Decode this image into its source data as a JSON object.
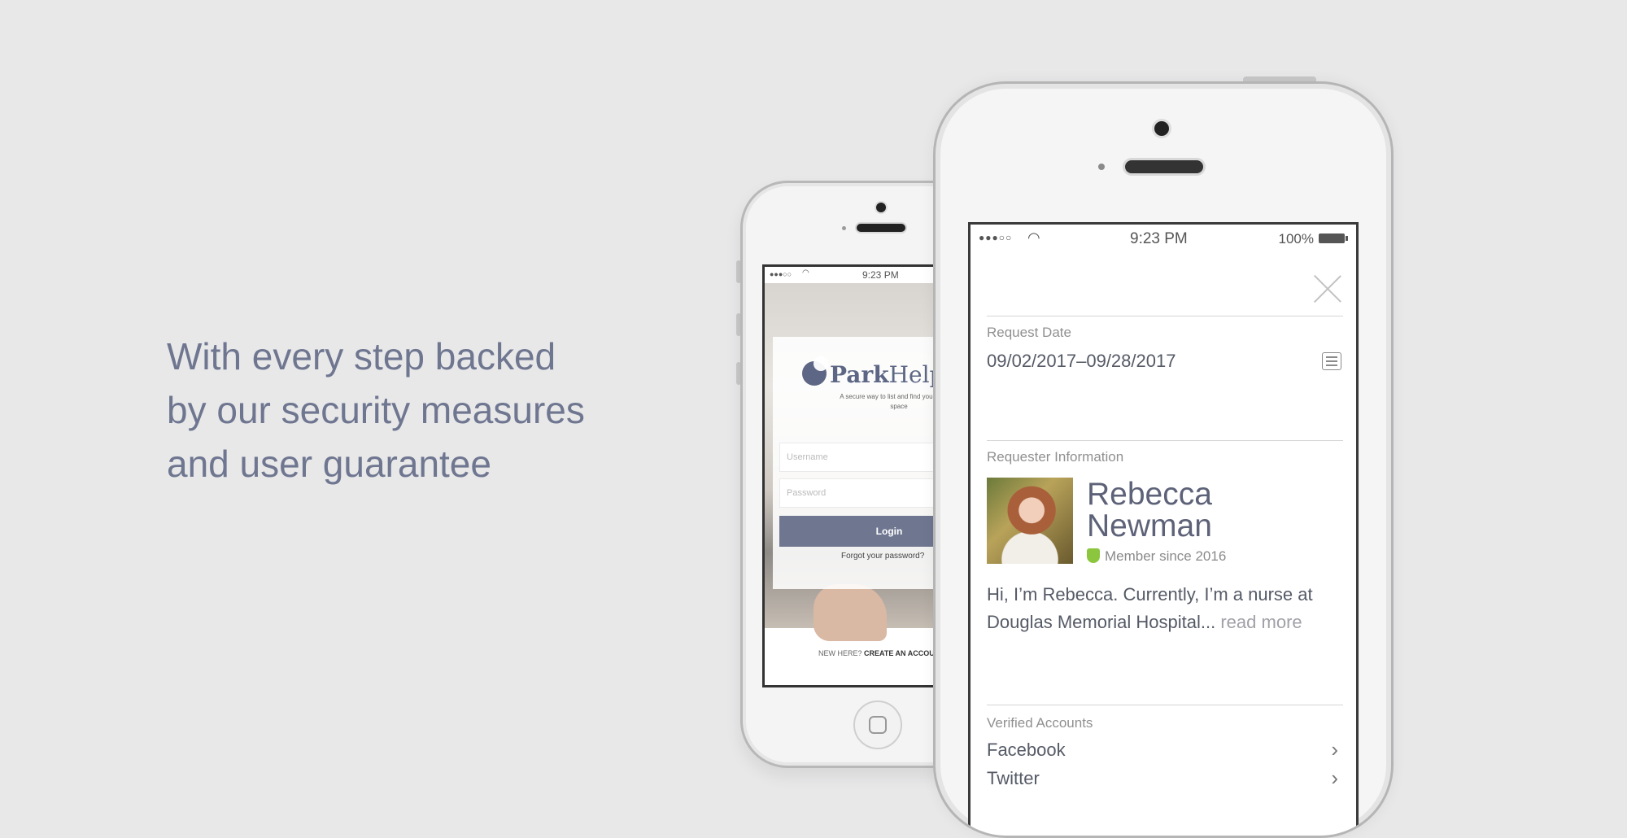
{
  "tagline": [
    "With every step backed",
    "by our security measures",
    "and user guarantee"
  ],
  "login_screen": {
    "status_time": "9:23 PM",
    "logo_bold": "Park",
    "logo_light": "Help",
    "tagline": "A secure way to list and find your parking space",
    "username_placeholder": "Username",
    "password_placeholder": "Password",
    "login_button": "Login",
    "forgot_link": "Forgot your password?",
    "new_here": "NEW HERE?",
    "create_account": "CREATE AN ACCOUNT"
  },
  "detail_screen": {
    "status_signal": "●●●○○",
    "status_time": "9:23 PM",
    "battery": "100%",
    "request_date_label": "Request Date",
    "request_date_value": "09/02/2017–09/28/2017",
    "requester_label": "Requester Information",
    "first_name": "Rebecca",
    "last_name": "Newman",
    "member_since": "Member since 2016",
    "bio": "Hi, I’m Rebecca. Currently, I’m a nurse at Douglas Memorial Hospital...",
    "read_more": "read more",
    "verified_label": "Verified Accounts",
    "accounts": [
      "Facebook",
      "Twitter"
    ]
  },
  "colors": {
    "background": "#e8e8e9",
    "accent": "#6f7690",
    "verified": "#8cc63f"
  }
}
